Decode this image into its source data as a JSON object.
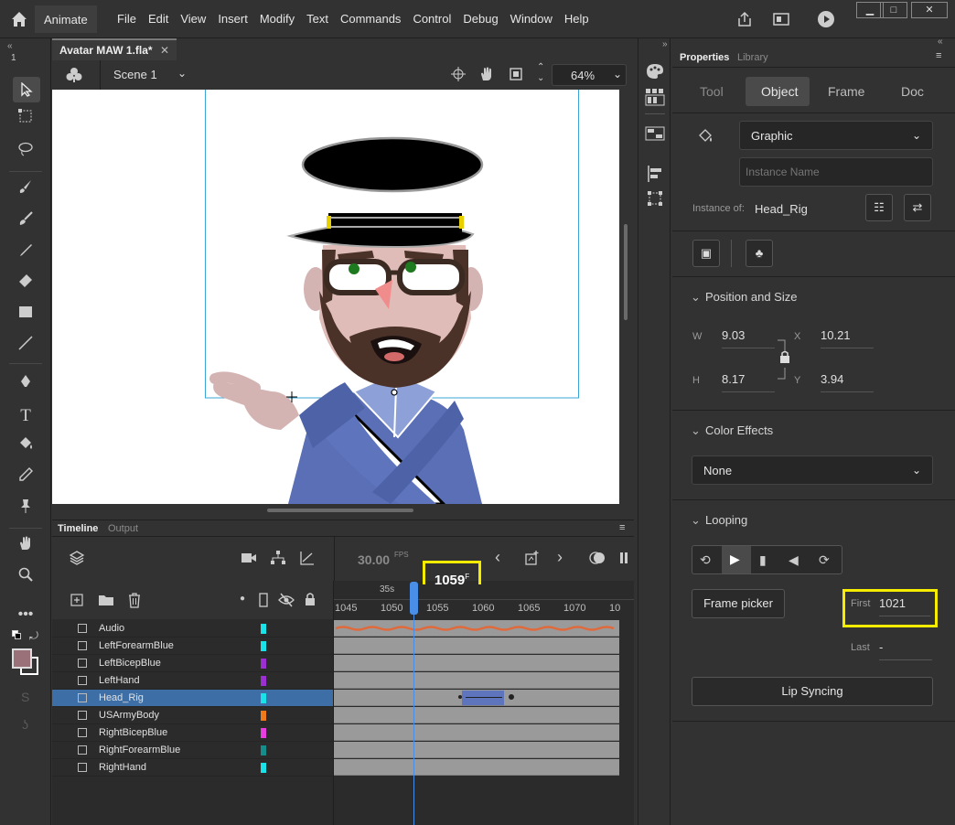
{
  "menubar": {
    "app_name": "Animate",
    "menus": [
      "File",
      "Edit",
      "View",
      "Insert",
      "Modify",
      "Text",
      "Commands",
      "Control",
      "Debug",
      "Window",
      "Help"
    ],
    "window_buttons": [
      "▁",
      "□",
      "✕"
    ]
  },
  "document": {
    "tab_title": "Avatar MAW 1.fla*",
    "scene": "Scene 1",
    "zoom": "64%"
  },
  "tools_panel": {
    "counter": "1"
  },
  "timeline": {
    "tabs": [
      "Timeline",
      "Output"
    ],
    "fps": "30.00",
    "fps_unit": "FPS",
    "current_frame": "1059",
    "frame_unit": "F",
    "time_marker": "35s",
    "ruler_ticks": [
      "1045",
      "1050",
      "1055",
      "1060",
      "1065",
      "1070",
      "10"
    ],
    "layers": [
      {
        "name": "Audio",
        "color": "#19e3e8"
      },
      {
        "name": "LeftForearmBlue",
        "color": "#19e3e8"
      },
      {
        "name": "LeftBicepBlue",
        "color": "#9c2fd1"
      },
      {
        "name": "LeftHand",
        "color": "#9c2fd1"
      },
      {
        "name": "Head_Rig",
        "color": "#19e3e8",
        "selected": true
      },
      {
        "name": "USArmyBody",
        "color": "#f0791a"
      },
      {
        "name": "RightBicepBlue",
        "color": "#e83ee0"
      },
      {
        "name": "RightForearmBlue",
        "color": "#138e8c"
      },
      {
        "name": "RightHand",
        "color": "#19e3e8"
      }
    ]
  },
  "properties": {
    "panel_tabs": [
      "Properties",
      "Library"
    ],
    "mode_tabs": [
      "Tool",
      "Object",
      "Frame",
      "Doc"
    ],
    "symbol_type": "Graphic",
    "instance_name_placeholder": "Instance Name",
    "instance_of_label": "Instance of:",
    "instance_of_value": "Head_Rig",
    "position_size": {
      "title": "Position and Size",
      "w_label": "W",
      "w": "9.03",
      "x_label": "X",
      "x": "10.21",
      "h_label": "H",
      "h": "8.17",
      "y_label": "Y",
      "y": "3.94"
    },
    "color_effects": {
      "title": "Color Effects",
      "value": "None"
    },
    "looping": {
      "title": "Looping",
      "frame_picker": "Frame picker",
      "first_label": "First",
      "first_value": "1021",
      "last_label": "Last",
      "last_value": "-"
    },
    "lip_syncing": "Lip Syncing"
  },
  "colors": {
    "highlight": "#f6ec00",
    "accent": "#4a8fe7",
    "selected_layer": "#3e6ea6",
    "stroke_swatch": "#9a7079"
  }
}
